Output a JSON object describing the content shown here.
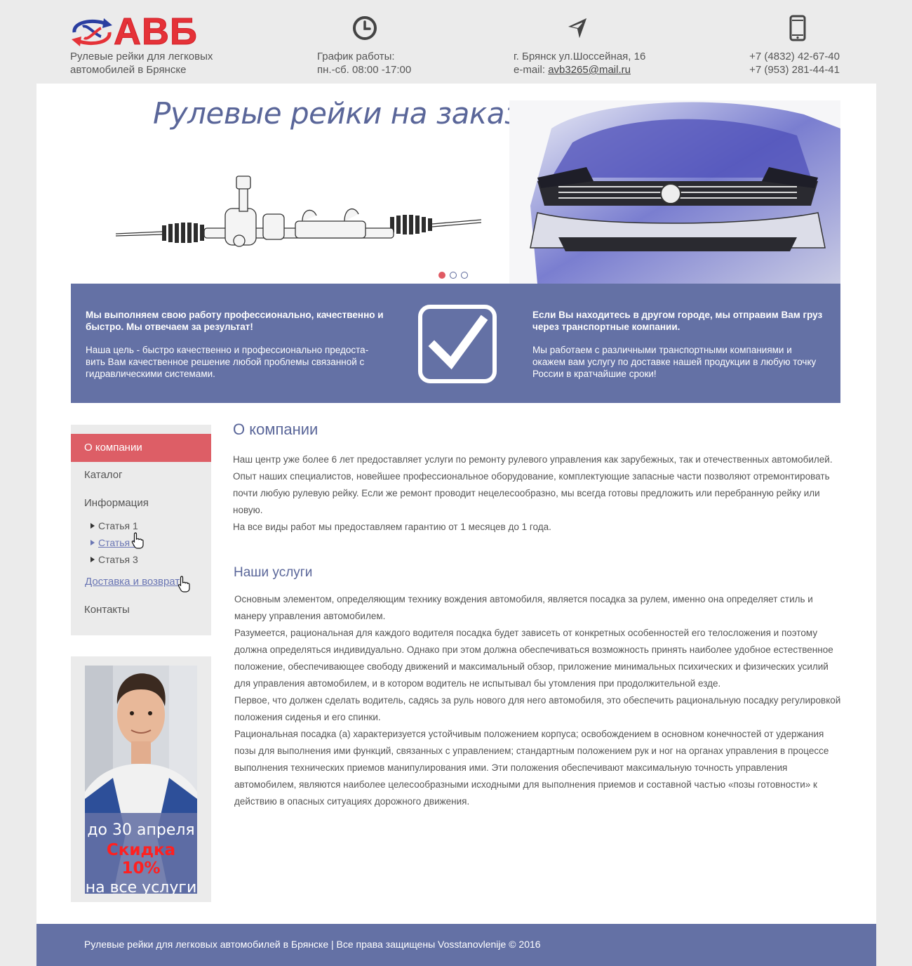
{
  "header": {
    "logo_text": "АВБ",
    "tagline_line1": "Рулевые рейки для легковых",
    "tagline_line2": "автомобилей в Брянске",
    "hours_label": "График работы:",
    "hours_value": "пн.-сб. 08:00 -17:00",
    "address": "г. Брянск ул.Шоссейная, 16",
    "email_label": "e-mail: ",
    "email": "avb3265@mail.ru",
    "phone1": "+7 (4832) 42-67-40",
    "phone2": "+7 (953) 281-44-41",
    "icons": [
      "clock-icon",
      "location-arrow-icon",
      "mobile-phone-icon"
    ]
  },
  "slider": {
    "title": "Рулевые рейки на заказ",
    "dots_count": 3,
    "active_dot": 1
  },
  "banner": {
    "left_title": "Мы выполняем свою работу профессионально, качественно и быстро. Мы отвечаем за результат!",
    "left_text": "Наша цель - быстро качественно и профессионально предоста-вить Вам качественное решение любой проблемы связанной с гидравлическими системами.",
    "right_title": "Если Вы находитесь в другом городе, мы отправим Вам груз через транспортные компании.",
    "right_text": "Мы работаем с различными транспортными компаниями и окажем вам услугу по доставке нашей продукции в любую точку России в кратчайшие сроки!",
    "icon": "checkbox-checked-icon"
  },
  "nav": {
    "items": [
      "О компании",
      "Каталог",
      "Информация",
      "Доставка и возврат",
      "Контакты"
    ],
    "sub_items": [
      "Статья 1",
      "Статья 2",
      "Статья 3"
    ]
  },
  "promo": {
    "line1": "до 30 апреля",
    "line2": "Скидка 10%",
    "line3": "на все услуги"
  },
  "about": {
    "title": "О компании",
    "p1": "Наш центр уже более 6 лет предоставляет услуги по ремонту рулевого управления как зарубежных, так и отечественных автомобилей. Опыт наших специалистов, новейшее профессиональное оборудование, комплектующие запасные части позволяют отремонтировать почти любую рулевую рейку. Если же ремонт проводит нецелесообразно, мы всегда готовы предложить или перебранную рейку или новую.",
    "p2": "На все виды работ мы предоставляем гарантию от 1 месяцев до 1 года."
  },
  "services": {
    "title": "Наши услуги",
    "p1": "Основным элементом, определяющим технику вождения автомобиля, является посадка за рулем, именно она определяет стиль и манеру управления автомобилем.",
    "p2": "Разумеется, рациональная для каждого водителя посадка будет зависеть от конкретных особенностей его телосложения и поэтому должна определяться индивидуально. Однако при этом должна обеспечиваться возможность принять наиболее удобное естественное положение, обеспечивающее свободу движений и максимальный обзор, приложение минимальных психических и физических усилий для управления автомобилем, и в котором водитель не испытывал бы утомления при продолжительной езде.",
    "p3": "Первое, что должен сделать водитель, садясь за руль нового для него автомобиля, это обеспечить рациональную посадку регулировкой положения сиденья и его спинки.",
    "p4": "Рациональная посадка (а) характеризуется устойчивым положением корпуса; освобождением в основном конечностей от удержания позы для выполнения ими функций, связанных с управлением; стандартным положением рук и ног на органах управления в процессе выполнения технических приемов манипулирования ими. Эти положения обеспечивают максимальную точность управления автомобилем, являются наиболее целесообразными исходными для выполнения приемов и составной частью «позы готовности» к действию в опасных ситуациях дорожного движения."
  },
  "footer": {
    "text": "Рулевые рейки для легковых автомобилей в Брянске | Все права защищены Vosstanovlenije © 2016"
  },
  "colors": {
    "accent": "#6471a5",
    "active_nav": "#dd5e66",
    "logo_red": "#e53238",
    "logo_blue": "#2a3ea0",
    "promo_red": "#ff2020"
  }
}
